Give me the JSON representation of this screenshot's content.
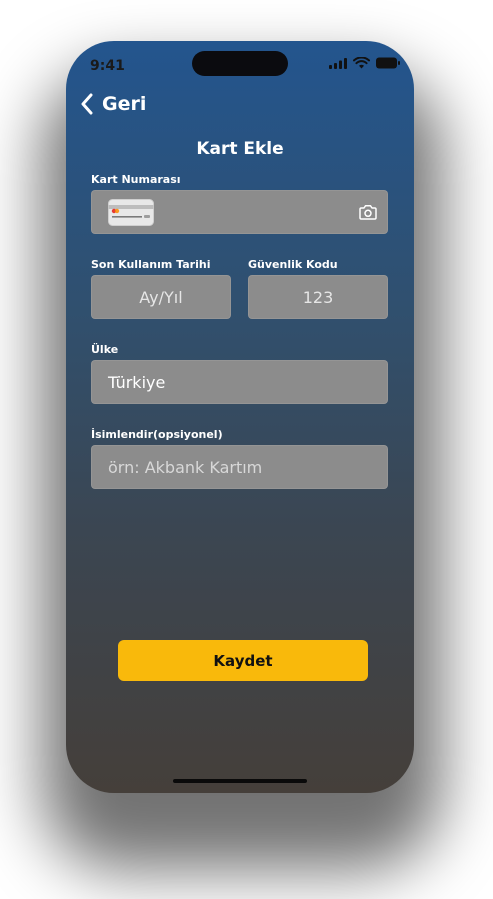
{
  "status_bar": {
    "time": "9:41"
  },
  "nav": {
    "back_label": "Geri"
  },
  "page": {
    "title": "Kart Ekle"
  },
  "form": {
    "card_number": {
      "label": "Kart Numarası",
      "value": ""
    },
    "expiry": {
      "label": "Son Kullanım Tarihi",
      "placeholder": "Ay/Yıl"
    },
    "cvv": {
      "label": "Güvenlik Kodu",
      "placeholder": "123"
    },
    "country": {
      "label": "Ülke",
      "value": "Türkiye"
    },
    "nickname": {
      "label": "İsimlendir(opsiyonel)",
      "placeholder": "örn: Akbank Kartım"
    }
  },
  "actions": {
    "save_label": "Kaydet"
  },
  "colors": {
    "accent": "#f9b90b",
    "field_bg": "#8c8c8c",
    "bg_top": "#23558e",
    "bg_bottom": "#453f3a"
  },
  "icons": [
    "chevron-left-icon",
    "credit-card-icon",
    "camera-icon",
    "signal-icon",
    "wifi-icon",
    "battery-icon"
  ]
}
